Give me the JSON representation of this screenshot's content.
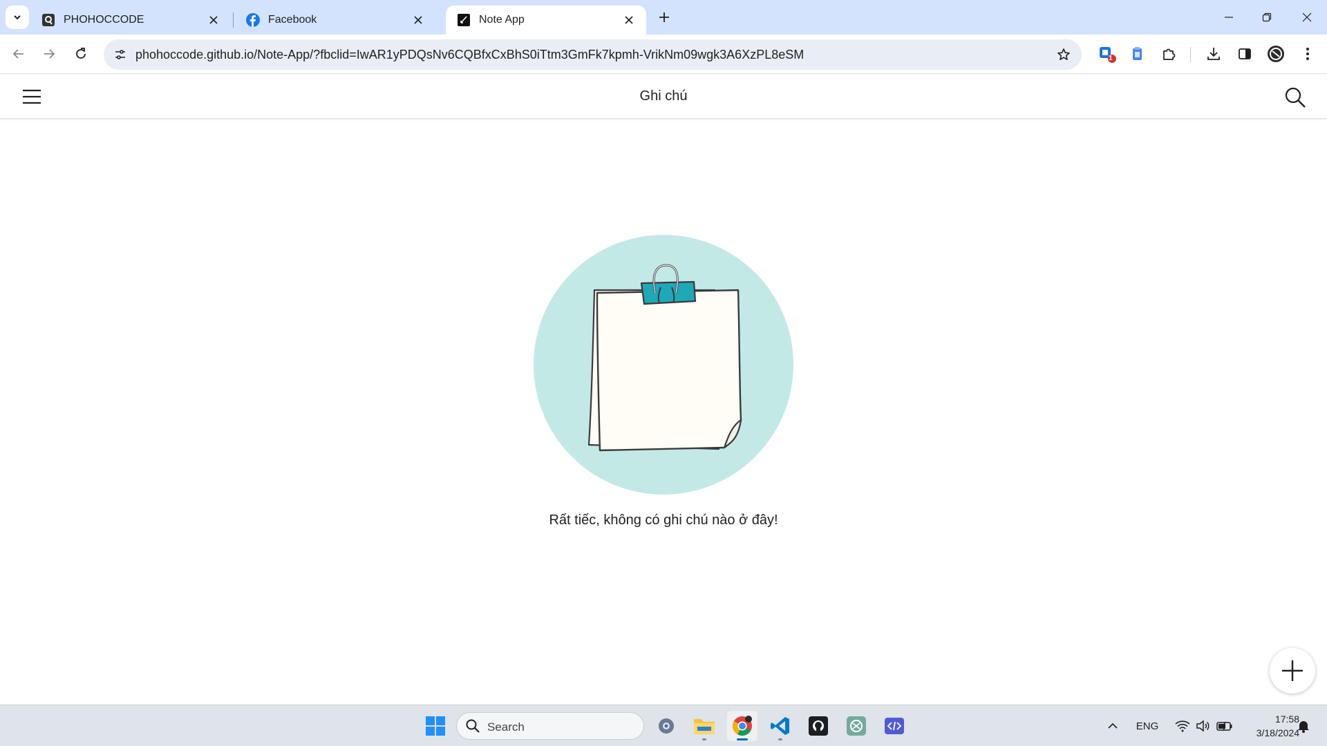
{
  "browser": {
    "tabs": [
      {
        "title": "PHOHOCCODE",
        "icon": "phohoccode-favicon-icon",
        "active": false
      },
      {
        "title": "Facebook",
        "icon": "facebook-icon",
        "active": false
      },
      {
        "title": "Note App",
        "icon": "note-app-favicon-icon",
        "active": true
      }
    ],
    "url": "phohoccode.github.io/Note-App/?fbclid=IwAR1yPDQsNv6CQBfxCxBhS0iTtm3GmFk7kpmh-VrikNm09wgk3A6XzPL8eSM",
    "extensions_badge": "1"
  },
  "app": {
    "title": "Ghi chú",
    "empty_message": "Rất tiếc, không có ghi chú nào ở đây!",
    "colors": {
      "illustration_circle": "#c3e9e6",
      "clip": "#1fa8b8",
      "paper": "#fffdf5"
    }
  },
  "taskbar": {
    "search_label": "Search",
    "language": "ENG",
    "time": "17:58",
    "date": "3/18/2024"
  }
}
